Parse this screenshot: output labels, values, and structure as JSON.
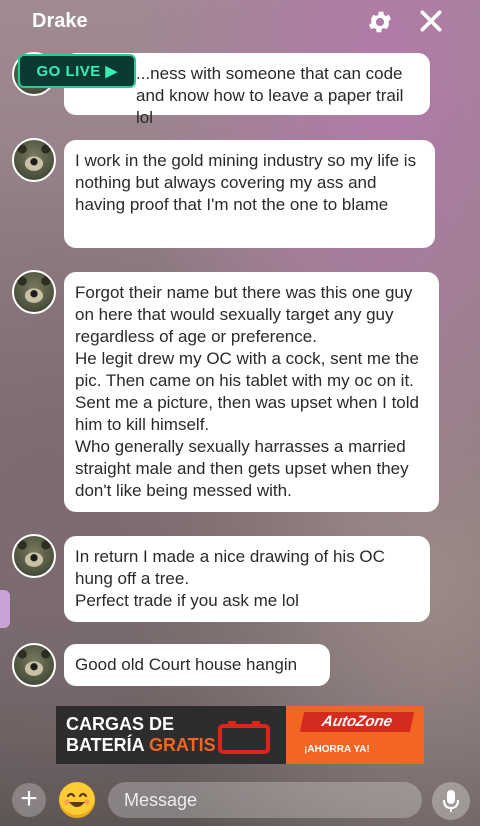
{
  "header": {
    "title": "Drake",
    "settings_icon": "gear-icon",
    "close_icon": "close-icon"
  },
  "go_live": {
    "label": "GO LIVE ▶"
  },
  "messages": [
    {
      "text": "...ness with someone that can code\nand know how to leave a paper trail lol"
    },
    {
      "text": "I work in the gold mining industry so my life is nothing but always covering my ass and having proof that I'm not the one to blame"
    },
    {
      "text": "Forgot their name but there was this one guy on here that would sexually target any guy regardless of age or preference.\nHe legit drew my OC with a cock, sent me the pic. Then came on his tablet with my oc on it. Sent me a picture, then was upset when I told him to kill himself.\nWho generally sexually harrasses a married straight male and then gets upset when they don't like being messed with."
    },
    {
      "text": "In return I made a nice drawing of his OC hung off a tree.\nPerfect trade if you ask me lol"
    },
    {
      "text": "Good old Court house hangin"
    }
  ],
  "ad": {
    "line1": "CARGAS DE",
    "line2": "BATERÍA",
    "highlight": "GRATIS",
    "brand": "AutoZone",
    "slogan": "¡AHORRA YA!"
  },
  "composer": {
    "placeholder": "Message",
    "add_icon": "plus-icon",
    "emoji_icon": "emoji-icon",
    "mic_icon": "microphone-icon"
  }
}
